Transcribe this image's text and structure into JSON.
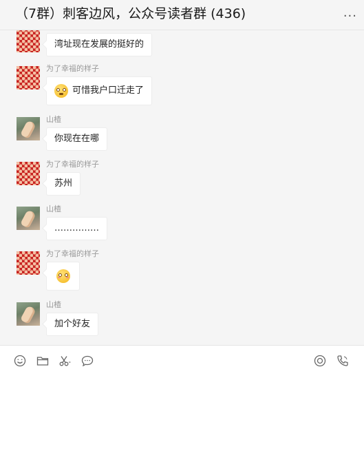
{
  "header": {
    "title": "（7群）刺客边风，公众号读者群 (436)",
    "more": "..."
  },
  "messages": [
    {
      "sender": "",
      "text": "湾址现在发展的挺好的"
    },
    {
      "sender": "为了幸福的样子",
      "text": "可惜我户口迁走了"
    },
    {
      "sender": "山楂",
      "text": "你现在在哪"
    },
    {
      "sender": "为了幸福的样子",
      "text": "苏州"
    },
    {
      "sender": "山楂",
      "text": "……………"
    },
    {
      "sender": "为了幸福的样子",
      "text": ""
    },
    {
      "sender": "山楂",
      "text": "加个好友"
    }
  ],
  "toolbar": {
    "icons": [
      "emoji-icon",
      "folder-icon",
      "scissors-icon",
      "chat-bubble-icon",
      "record-icon",
      "phone-icon"
    ]
  }
}
